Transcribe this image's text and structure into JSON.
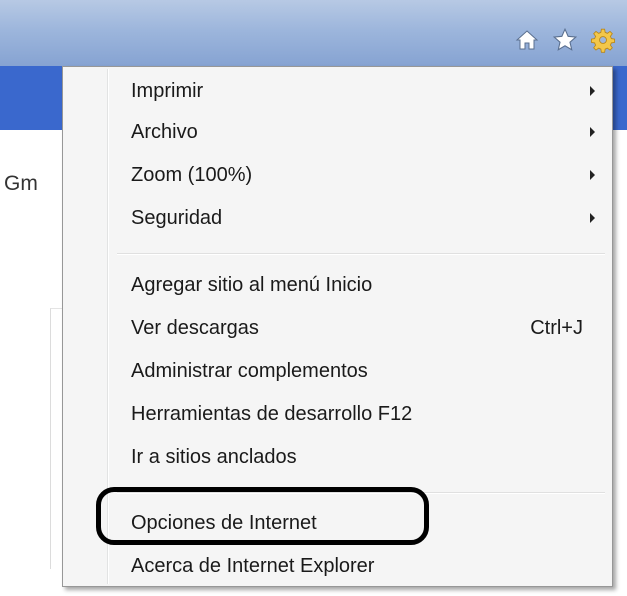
{
  "toolbar": {
    "icons": [
      {
        "name": "home-icon",
        "color": "#ffffff"
      },
      {
        "name": "star-icon",
        "color": "#ffffff"
      },
      {
        "name": "gear-icon",
        "color": "#f3c74a"
      }
    ]
  },
  "page": {
    "partial_text": "Gm"
  },
  "menu": {
    "items": [
      {
        "label": "Imprimir",
        "submenu": true
      },
      {
        "label": "Archivo",
        "submenu": true
      },
      {
        "label": "Zoom (100%)",
        "submenu": true
      },
      {
        "label": "Seguridad",
        "submenu": true
      },
      {
        "label": "Agregar sitio al menú Inicio"
      },
      {
        "label": "Ver descargas",
        "shortcut": "Ctrl+J"
      },
      {
        "label": "Administrar complementos"
      },
      {
        "label": "Herramientas de desarrollo F12"
      },
      {
        "label": "Ir a sitios anclados"
      },
      {
        "label": "Opciones de Internet",
        "highlighted": true
      },
      {
        "label": "Acerca de Internet Explorer"
      }
    ]
  },
  "colors": {
    "titlebar": "#9db6dc",
    "blue_band": "#3a68cd",
    "menu_background": "#f5f5f5",
    "annotation_ring": "#000000"
  }
}
